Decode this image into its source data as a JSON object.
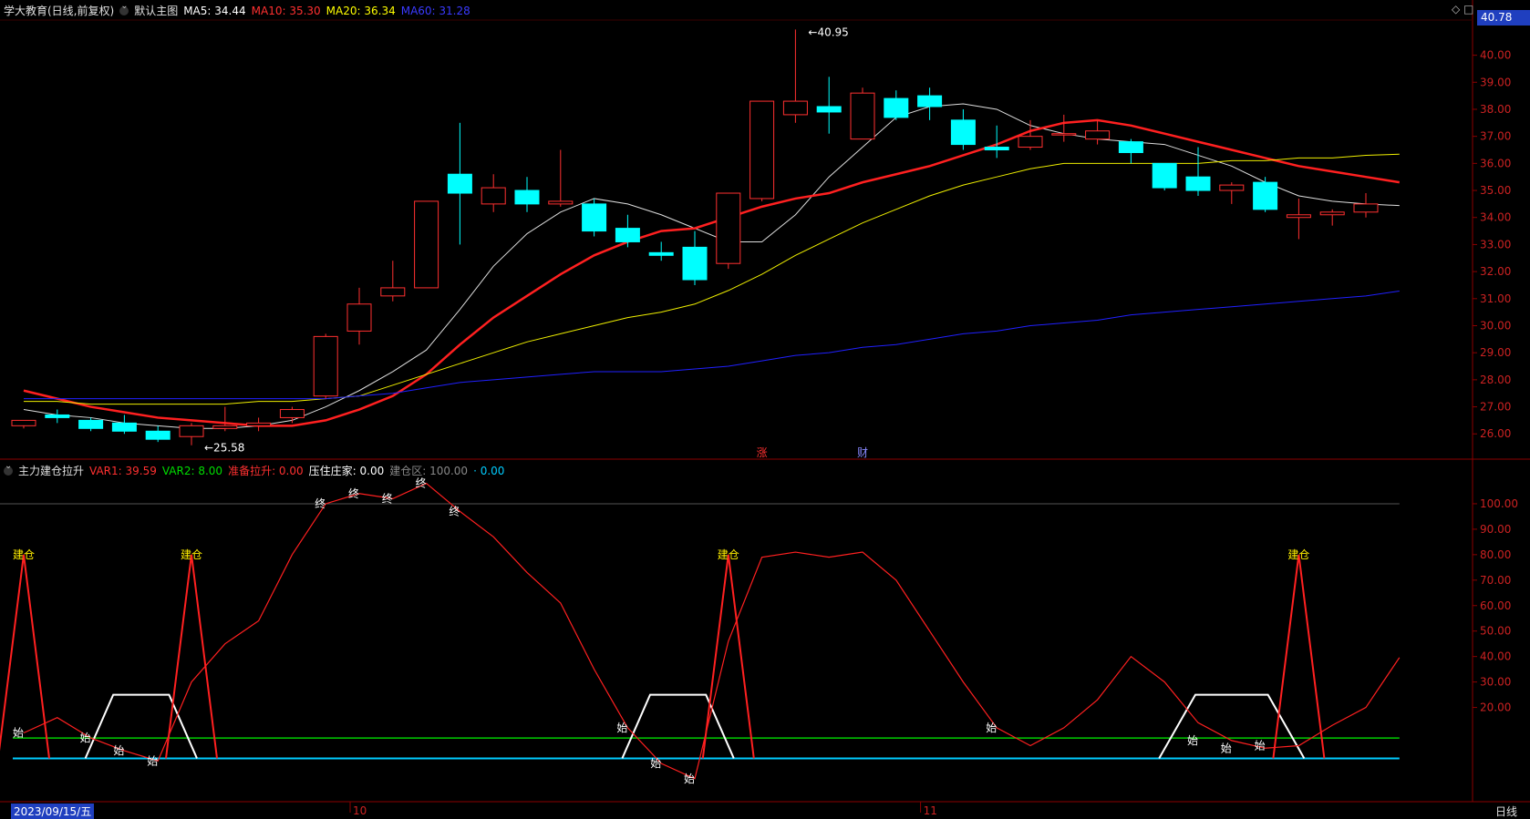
{
  "header": {
    "stock_name": "学大教育(日线,前复权)",
    "main_chart_label": "默认主图",
    "ma": [
      {
        "label": "MA5: 34.44",
        "color": "#ffffff"
      },
      {
        "label": "MA10: 35.30",
        "color": "#ff3030"
      },
      {
        "label": "MA20: 36.34",
        "color": "#ffff00"
      },
      {
        "label": "MA60: 31.28",
        "color": "#3030ff"
      }
    ]
  },
  "indicator_header": {
    "name": "主力建仓拉升",
    "items": [
      {
        "label": "VAR1: 39.59",
        "color": "#ff3030"
      },
      {
        "label": "VAR2: 8.00",
        "color": "#00dd00"
      },
      {
        "label": "准备拉升: 0.00",
        "color": "#ff3030"
      },
      {
        "label": "压住庄家: 0.00",
        "color": "#ffffff"
      },
      {
        "label": "建仓区: 100.00",
        "color": "#888888"
      },
      {
        "label": "· 0.00",
        "color": "#00ccff"
      }
    ]
  },
  "current_price_tag": "40.78",
  "x_axis": {
    "date_label": "2023/09/15/五",
    "month_labels": [
      {
        "label": "10",
        "index": 10
      },
      {
        "label": "11",
        "index": 27
      }
    ],
    "period_label": "日线"
  },
  "chart_data": [
    {
      "type": "candlestick",
      "y_ticks": [
        26.0,
        27.0,
        28.0,
        29.0,
        30.0,
        31.0,
        32.0,
        33.0,
        34.0,
        35.0,
        36.0,
        37.0,
        38.0,
        39.0,
        40.0
      ],
      "ylim": [
        25.2,
        41.3
      ],
      "candles": [
        {
          "o": 26.3,
          "h": 26.5,
          "l": 26.2,
          "c": 26.5
        },
        {
          "o": 26.7,
          "h": 26.9,
          "l": 26.4,
          "c": 26.6
        },
        {
          "o": 26.5,
          "h": 26.6,
          "l": 26.1,
          "c": 26.2
        },
        {
          "o": 26.4,
          "h": 26.7,
          "l": 26.0,
          "c": 26.1
        },
        {
          "o": 26.1,
          "h": 26.3,
          "l": 25.7,
          "c": 25.8
        },
        {
          "o": 25.9,
          "h": 26.4,
          "l": 25.58,
          "c": 26.3
        },
        {
          "o": 26.2,
          "h": 27.0,
          "l": 26.1,
          "c": 26.3
        },
        {
          "o": 26.3,
          "h": 26.6,
          "l": 26.1,
          "c": 26.4
        },
        {
          "o": 26.6,
          "h": 27.0,
          "l": 26.4,
          "c": 26.9
        },
        {
          "o": 27.4,
          "h": 29.7,
          "l": 27.3,
          "c": 29.6
        },
        {
          "o": 29.8,
          "h": 31.4,
          "l": 29.3,
          "c": 30.8
        },
        {
          "o": 31.1,
          "h": 32.4,
          "l": 30.9,
          "c": 31.4
        },
        {
          "o": 31.4,
          "h": 34.6,
          "l": 31.4,
          "c": 34.6
        },
        {
          "o": 35.6,
          "h": 37.5,
          "l": 33.0,
          "c": 34.9
        },
        {
          "o": 34.5,
          "h": 35.6,
          "l": 34.2,
          "c": 35.1
        },
        {
          "o": 35.0,
          "h": 35.5,
          "l": 34.2,
          "c": 34.5
        },
        {
          "o": 34.5,
          "h": 36.5,
          "l": 34.4,
          "c": 34.6
        },
        {
          "o": 34.5,
          "h": 34.7,
          "l": 33.3,
          "c": 33.5
        },
        {
          "o": 33.6,
          "h": 34.1,
          "l": 32.9,
          "c": 33.1
        },
        {
          "o": 32.7,
          "h": 33.1,
          "l": 32.4,
          "c": 32.6
        },
        {
          "o": 32.9,
          "h": 33.5,
          "l": 31.5,
          "c": 31.7
        },
        {
          "o": 32.3,
          "h": 34.9,
          "l": 32.1,
          "c": 34.9
        },
        {
          "o": 34.7,
          "h": 38.3,
          "l": 34.6,
          "c": 38.3
        },
        {
          "o": 37.8,
          "h": 40.95,
          "l": 37.5,
          "c": 38.3
        },
        {
          "o": 38.1,
          "h": 39.2,
          "l": 37.1,
          "c": 37.9
        },
        {
          "o": 36.9,
          "h": 38.8,
          "l": 36.9,
          "c": 38.6
        },
        {
          "o": 38.4,
          "h": 38.7,
          "l": 37.6,
          "c": 37.7
        },
        {
          "o": 38.5,
          "h": 38.8,
          "l": 37.6,
          "c": 38.1
        },
        {
          "o": 37.6,
          "h": 38.0,
          "l": 36.5,
          "c": 36.7
        },
        {
          "o": 36.6,
          "h": 37.4,
          "l": 36.2,
          "c": 36.5
        },
        {
          "o": 36.6,
          "h": 37.6,
          "l": 36.5,
          "c": 37.0
        },
        {
          "o": 37.1,
          "h": 37.8,
          "l": 36.8,
          "c": 37.1
        },
        {
          "o": 36.9,
          "h": 37.6,
          "l": 36.7,
          "c": 37.2
        },
        {
          "o": 36.8,
          "h": 36.9,
          "l": 36.0,
          "c": 36.4
        },
        {
          "o": 36.0,
          "h": 36.0,
          "l": 35.0,
          "c": 35.1
        },
        {
          "o": 35.5,
          "h": 36.6,
          "l": 34.8,
          "c": 35.0
        },
        {
          "o": 35.0,
          "h": 35.3,
          "l": 34.5,
          "c": 35.2
        },
        {
          "o": 35.3,
          "h": 35.5,
          "l": 34.2,
          "c": 34.3
        },
        {
          "o": 34.0,
          "h": 34.7,
          "l": 33.2,
          "c": 34.1
        },
        {
          "o": 34.1,
          "h": 34.3,
          "l": 33.7,
          "c": 34.2
        },
        {
          "o": 34.2,
          "h": 34.9,
          "l": 34.0,
          "c": 34.5
        }
      ],
      "annotations": [
        {
          "label": "40.95",
          "index": 23,
          "value": 40.95
        },
        {
          "label": "25.58",
          "index": 5,
          "value": 25.58
        }
      ],
      "markers": [
        {
          "label": "涨",
          "index": 22,
          "color": "#ff3030"
        },
        {
          "label": "财",
          "index": 25,
          "color": "#8888ff"
        }
      ],
      "series": [
        {
          "name": "MA5",
          "color": "#dddddd",
          "width": 1,
          "values": [
            26.9,
            26.7,
            26.6,
            26.4,
            26.3,
            26.2,
            26.2,
            26.3,
            26.5,
            27.0,
            27.6,
            28.3,
            29.1,
            30.6,
            32.2,
            33.4,
            34.2,
            34.7,
            34.5,
            34.1,
            33.6,
            33.1,
            33.1,
            34.1,
            35.5,
            36.6,
            37.7,
            38.1,
            38.2,
            38.0,
            37.4,
            37.1,
            36.9,
            36.8,
            36.7,
            36.3,
            35.9,
            35.3,
            34.8,
            34.6,
            34.5,
            34.44
          ]
        },
        {
          "name": "MA10",
          "color": "#ff2020",
          "width": 2.5,
          "values": [
            27.6,
            27.3,
            27.0,
            26.8,
            26.6,
            26.5,
            26.4,
            26.3,
            26.3,
            26.5,
            26.9,
            27.4,
            28.2,
            29.3,
            30.3,
            31.1,
            31.9,
            32.6,
            33.1,
            33.5,
            33.6,
            34.0,
            34.4,
            34.7,
            34.9,
            35.3,
            35.6,
            35.9,
            36.3,
            36.7,
            37.2,
            37.5,
            37.6,
            37.4,
            37.1,
            36.8,
            36.5,
            36.2,
            35.9,
            35.7,
            35.5,
            35.3
          ]
        },
        {
          "name": "MA20",
          "color": "#eeee00",
          "width": 1,
          "values": [
            27.2,
            27.2,
            27.1,
            27.1,
            27.1,
            27.1,
            27.1,
            27.2,
            27.2,
            27.3,
            27.4,
            27.8,
            28.2,
            28.6,
            29.0,
            29.4,
            29.7,
            30.0,
            30.3,
            30.5,
            30.8,
            31.3,
            31.9,
            32.6,
            33.2,
            33.8,
            34.3,
            34.8,
            35.2,
            35.5,
            35.8,
            36.0,
            36.0,
            36.0,
            36.0,
            36.0,
            36.1,
            36.1,
            36.2,
            36.2,
            36.3,
            36.34
          ]
        },
        {
          "name": "MA60",
          "color": "#2020ff",
          "width": 1,
          "values": [
            27.3,
            27.3,
            27.3,
            27.3,
            27.3,
            27.3,
            27.3,
            27.3,
            27.3,
            27.3,
            27.4,
            27.5,
            27.7,
            27.9,
            28.0,
            28.1,
            28.2,
            28.3,
            28.3,
            28.3,
            28.4,
            28.5,
            28.7,
            28.9,
            29.0,
            29.2,
            29.3,
            29.5,
            29.7,
            29.8,
            30.0,
            30.1,
            30.2,
            30.4,
            30.5,
            30.6,
            30.7,
            30.8,
            30.9,
            31.0,
            31.1,
            31.28
          ]
        }
      ]
    },
    {
      "type": "line",
      "y_ticks": [
        20.0,
        30.0,
        40.0,
        50.0,
        60.0,
        70.0,
        80.0,
        90.0,
        100.0
      ],
      "ylim": [
        -12,
        110
      ],
      "zone_line": 100,
      "green_line": 8,
      "cyan_line": 0,
      "var1": {
        "name": "VAR1",
        "color": "#ff2020",
        "values": [
          10,
          16,
          8,
          3,
          -1,
          30,
          45,
          54,
          80,
          100,
          104,
          102,
          108,
          97,
          87,
          73,
          61,
          35,
          12,
          -2,
          -8,
          46,
          79,
          81,
          79,
          81,
          70,
          50,
          30,
          12,
          5,
          12,
          23,
          40,
          30,
          14,
          7,
          4,
          5,
          13,
          20,
          39.59
        ]
      },
      "var2_pulses": [
        {
          "index": 0,
          "value": 80
        },
        {
          "index": 5,
          "value": 80
        },
        {
          "index": 21,
          "value": 80
        },
        {
          "index": 38,
          "value": 80
        }
      ],
      "trapezoids": [
        {
          "start": 2,
          "end": 5,
          "height": 25
        },
        {
          "start": 18,
          "end": 21,
          "height": 25
        },
        {
          "start": 34,
          "end": 38,
          "height": 25
        }
      ],
      "labels": [
        {
          "label": "建仓",
          "index": 0,
          "value": 80,
          "color": "#ffee00"
        },
        {
          "label": "建仓",
          "index": 5,
          "value": 80,
          "color": "#ffee00"
        },
        {
          "label": "建仓",
          "index": 21,
          "value": 80,
          "color": "#ffee00"
        },
        {
          "label": "建仓",
          "index": 38,
          "value": 80,
          "color": "#ffee00"
        },
        {
          "label": "始",
          "index": 0,
          "value": 10,
          "color": "#ffffff"
        },
        {
          "label": "始",
          "index": 2,
          "value": 8,
          "color": "#ffffff"
        },
        {
          "label": "始",
          "index": 3,
          "value": 3,
          "color": "#ffffff"
        },
        {
          "label": "始",
          "index": 4,
          "value": -1,
          "color": "#ffffff"
        },
        {
          "label": "始",
          "index": 18,
          "value": 12,
          "color": "#ffffff"
        },
        {
          "label": "始",
          "index": 19,
          "value": -2,
          "color": "#ffffff"
        },
        {
          "label": "始",
          "index": 20,
          "value": -8,
          "color": "#ffffff"
        },
        {
          "label": "始",
          "index": 29,
          "value": 12,
          "color": "#ffffff"
        },
        {
          "label": "始",
          "index": 35,
          "value": 7,
          "color": "#ffffff"
        },
        {
          "label": "始",
          "index": 36,
          "value": 4,
          "color": "#ffffff"
        },
        {
          "label": "始",
          "index": 37,
          "value": 5,
          "color": "#ffffff"
        },
        {
          "label": "终",
          "index": 9,
          "value": 100,
          "color": "#ffffff"
        },
        {
          "label": "终",
          "index": 10,
          "value": 104,
          "color": "#ffffff"
        },
        {
          "label": "终",
          "index": 11,
          "value": 102,
          "color": "#ffffff"
        },
        {
          "label": "终",
          "index": 12,
          "value": 108,
          "color": "#ffffff"
        },
        {
          "label": "终",
          "index": 13,
          "value": 97,
          "color": "#ffffff"
        }
      ]
    }
  ]
}
